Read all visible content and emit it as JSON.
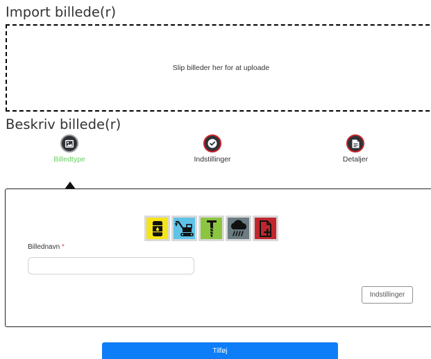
{
  "import": {
    "title": "Import billede(r)",
    "dropzone_text": "Slip billeder her for at uploade"
  },
  "describe": {
    "title": "Beskriv billede(r)"
  },
  "steps": [
    {
      "label": "Billedtype",
      "icon": "image-icon",
      "active": true
    },
    {
      "label": "Indstillinger",
      "icon": "check-icon",
      "active": false
    },
    {
      "label": "Detaljer",
      "icon": "document-icon",
      "active": false
    }
  ],
  "image_types": [
    {
      "icon": "oil-barrel-icon",
      "bg": "#f5e31b"
    },
    {
      "icon": "excavator-icon",
      "bg": "#5fc3e8"
    },
    {
      "icon": "drill-icon",
      "bg": "#8cc540"
    },
    {
      "icon": "rain-cloud-icon",
      "bg": "#6b7c82"
    },
    {
      "icon": "add-document-icon",
      "bg": "#c0272d"
    }
  ],
  "form": {
    "name_label": "Billednavn",
    "required_marker": "*",
    "name_value": "",
    "settings_button": "Indstillinger"
  },
  "submit_label": "Tilføj"
}
